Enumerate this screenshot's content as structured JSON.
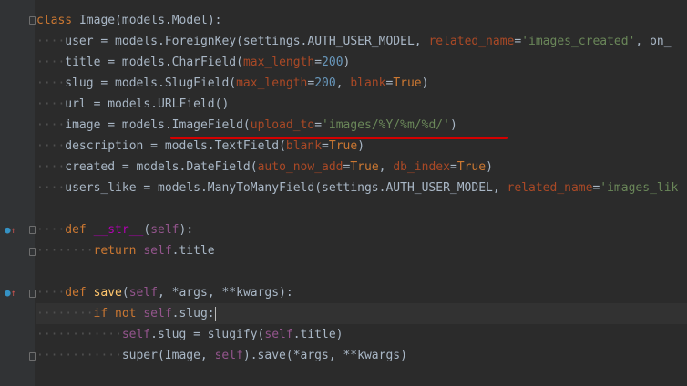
{
  "editor": {
    "lines": [
      {
        "indent": 0,
        "tokens": [
          {
            "t": "class ",
            "c": "kw"
          },
          {
            "t": "Image",
            "c": ""
          },
          {
            "t": "(models.Model):",
            "c": ""
          }
        ]
      },
      {
        "indent": 1,
        "tokens": [
          {
            "t": "user = models.ForeignKey(settings.AUTH_USER_MODEL, ",
            "c": ""
          },
          {
            "t": "related_name",
            "c": "kwarg"
          },
          {
            "t": "=",
            "c": ""
          },
          {
            "t": "'images_created'",
            "c": "str"
          },
          {
            "t": ", on_",
            "c": ""
          }
        ]
      },
      {
        "indent": 1,
        "tokens": [
          {
            "t": "title = models.CharField(",
            "c": ""
          },
          {
            "t": "max_length",
            "c": "kwarg"
          },
          {
            "t": "=",
            "c": ""
          },
          {
            "t": "200",
            "c": "num"
          },
          {
            "t": ")",
            "c": ""
          }
        ]
      },
      {
        "indent": 1,
        "tokens": [
          {
            "t": "slug = models.SlugField(",
            "c": ""
          },
          {
            "t": "max_length",
            "c": "kwarg"
          },
          {
            "t": "=",
            "c": ""
          },
          {
            "t": "200",
            "c": "num"
          },
          {
            "t": ", ",
            "c": ""
          },
          {
            "t": "blank",
            "c": "kwarg"
          },
          {
            "t": "=",
            "c": ""
          },
          {
            "t": "True",
            "c": "kw"
          },
          {
            "t": ")",
            "c": ""
          }
        ]
      },
      {
        "indent": 1,
        "tokens": [
          {
            "t": "url = models.URLField()",
            "c": ""
          }
        ]
      },
      {
        "indent": 1,
        "tokens": [
          {
            "t": "image = models.ImageField(",
            "c": ""
          },
          {
            "t": "upload_to",
            "c": "kwarg"
          },
          {
            "t": "=",
            "c": ""
          },
          {
            "t": "'images/%Y/%m/%d/'",
            "c": "str"
          },
          {
            "t": ")",
            "c": ""
          }
        ]
      },
      {
        "indent": 1,
        "tokens": [
          {
            "t": "description = models.TextField(",
            "c": ""
          },
          {
            "t": "blank",
            "c": "kwarg"
          },
          {
            "t": "=",
            "c": ""
          },
          {
            "t": "True",
            "c": "kw"
          },
          {
            "t": ")",
            "c": ""
          }
        ]
      },
      {
        "indent": 1,
        "tokens": [
          {
            "t": "created = models.DateField(",
            "c": ""
          },
          {
            "t": "auto_now_add",
            "c": "kwarg"
          },
          {
            "t": "=",
            "c": ""
          },
          {
            "t": "True",
            "c": "kw"
          },
          {
            "t": ", ",
            "c": ""
          },
          {
            "t": "db_index",
            "c": "kwarg"
          },
          {
            "t": "=",
            "c": ""
          },
          {
            "t": "True",
            "c": "kw"
          },
          {
            "t": ")",
            "c": ""
          }
        ]
      },
      {
        "indent": 1,
        "tokens": [
          {
            "t": "users_like = models.ManyToManyField(settings.AUTH_USER_MODEL, ",
            "c": ""
          },
          {
            "t": "related_name",
            "c": "kwarg"
          },
          {
            "t": "=",
            "c": ""
          },
          {
            "t": "'images_lik",
            "c": "str"
          }
        ]
      },
      {
        "indent": 0,
        "tokens": []
      },
      {
        "indent": 1,
        "tokens": [
          {
            "t": "def ",
            "c": "kw"
          },
          {
            "t": "__str__",
            "c": "magic"
          },
          {
            "t": "(",
            "c": ""
          },
          {
            "t": "self",
            "c": "self"
          },
          {
            "t": "):",
            "c": ""
          }
        ]
      },
      {
        "indent": 2,
        "tokens": [
          {
            "t": "return ",
            "c": "kw"
          },
          {
            "t": "self",
            "c": "self"
          },
          {
            "t": ".title",
            "c": ""
          }
        ]
      },
      {
        "indent": 0,
        "tokens": []
      },
      {
        "indent": 1,
        "tokens": [
          {
            "t": "def ",
            "c": "kw"
          },
          {
            "t": "save",
            "c": "fn"
          },
          {
            "t": "(",
            "c": ""
          },
          {
            "t": "self",
            "c": "self"
          },
          {
            "t": ", *args, **kwargs):",
            "c": ""
          }
        ]
      },
      {
        "indent": 2,
        "caret": true,
        "tokens": [
          {
            "t": "if not ",
            "c": "kw"
          },
          {
            "t": "self",
            "c": "self"
          },
          {
            "t": ".slug:",
            "c": ""
          }
        ]
      },
      {
        "indent": 3,
        "tokens": [
          {
            "t": "self",
            "c": "self"
          },
          {
            "t": ".slug = slugify(",
            "c": ""
          },
          {
            "t": "self",
            "c": "self"
          },
          {
            "t": ".title)",
            "c": ""
          }
        ]
      },
      {
        "indent": 3,
        "tokens": [
          {
            "t": "super",
            "c": ""
          },
          {
            "t": "(Image, ",
            "c": ""
          },
          {
            "t": "self",
            "c": "self"
          },
          {
            "t": ").save(*args, **kwargs)",
            "c": ""
          }
        ]
      }
    ]
  },
  "gutter": {
    "override_icons": [
      "override-icon",
      "override-icon"
    ],
    "bulb_icon": "intention-bulb-icon"
  },
  "colors": {
    "background": "#2b2b2b",
    "keyword": "#cc7832",
    "string": "#6a8759",
    "number": "#6897bb",
    "self": "#94558d",
    "underline": "#d40000"
  }
}
